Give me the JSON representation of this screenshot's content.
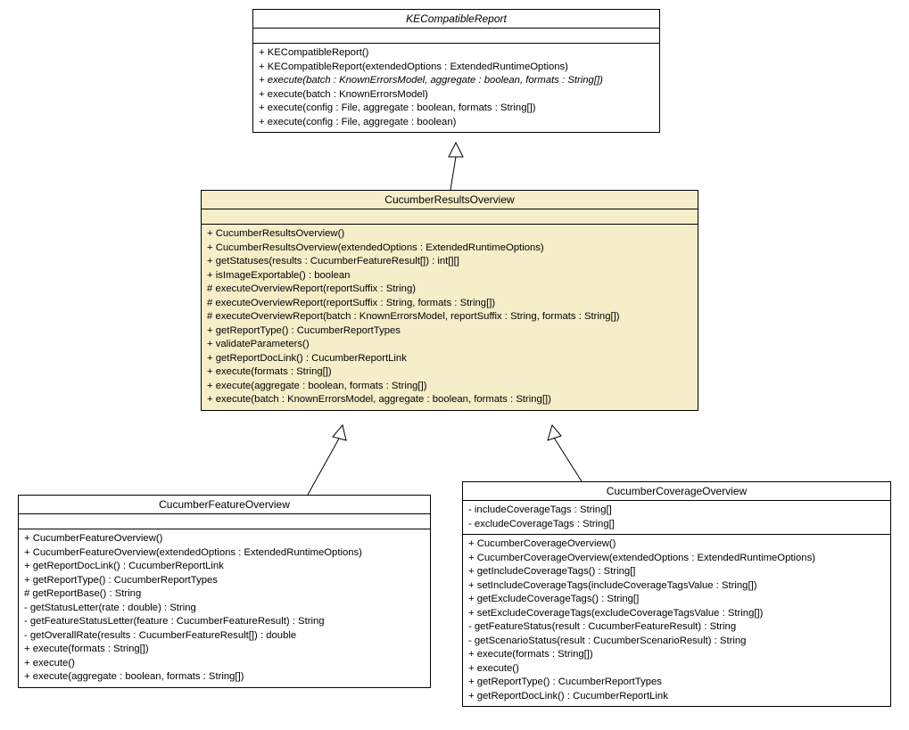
{
  "chart_data": {
    "type": "uml-class-diagram",
    "classes": [
      {
        "name": "KECompatibleReport",
        "abstract": true
      },
      {
        "name": "CucumberResultsOverview",
        "highlighted": true,
        "extends": "KECompatibleReport"
      },
      {
        "name": "CucumberFeatureOverview",
        "extends": "CucumberResultsOverview"
      },
      {
        "name": "CucumberCoverageOverview",
        "extends": "CucumberResultsOverview"
      }
    ],
    "relationships": [
      {
        "from": "CucumberResultsOverview",
        "to": "KECompatibleReport",
        "type": "generalization"
      },
      {
        "from": "CucumberFeatureOverview",
        "to": "CucumberResultsOverview",
        "type": "generalization"
      },
      {
        "from": "CucumberCoverageOverview",
        "to": "CucumberResultsOverview",
        "type": "generalization"
      }
    ]
  },
  "class1": {
    "title": "KECompatibleReport",
    "members": [
      {
        "sig": "+ KECompatibleReport()",
        "italic": false
      },
      {
        "sig": "+ KECompatibleReport(extendedOptions : ExtendedRuntimeOptions)",
        "italic": false
      },
      {
        "sig": "+ execute(batch : KnownErrorsModel, aggregate : boolean, formats : String[])",
        "italic": true
      },
      {
        "sig": "+ execute(batch : KnownErrorsModel)",
        "italic": false
      },
      {
        "sig": "+ execute(config : File, aggregate : boolean, formats : String[])",
        "italic": false
      },
      {
        "sig": "+ execute(config : File, aggregate : boolean)",
        "italic": false
      }
    ]
  },
  "class2": {
    "title": "CucumberResultsOverview",
    "members": [
      {
        "sig": "+ CucumberResultsOverview()",
        "italic": false
      },
      {
        "sig": "+ CucumberResultsOverview(extendedOptions : ExtendedRuntimeOptions)",
        "italic": false
      },
      {
        "sig": "+ getStatuses(results : CucumberFeatureResult[]) : int[][]",
        "italic": false
      },
      {
        "sig": "+ isImageExportable() : boolean",
        "italic": false
      },
      {
        "sig": "# executeOverviewReport(reportSuffix : String)",
        "italic": false
      },
      {
        "sig": "# executeOverviewReport(reportSuffix : String, formats : String[])",
        "italic": false
      },
      {
        "sig": "# executeOverviewReport(batch : KnownErrorsModel, reportSuffix : String, formats : String[])",
        "italic": false
      },
      {
        "sig": "+ getReportType() : CucumberReportTypes",
        "italic": false
      },
      {
        "sig": "+ validateParameters()",
        "italic": false
      },
      {
        "sig": "+ getReportDocLink() : CucumberReportLink",
        "italic": false
      },
      {
        "sig": "+ execute(formats : String[])",
        "italic": false
      },
      {
        "sig": "+ execute(aggregate : boolean, formats : String[])",
        "italic": false
      },
      {
        "sig": "+ execute(batch : KnownErrorsModel, aggregate : boolean, formats : String[])",
        "italic": false
      }
    ]
  },
  "class3": {
    "title": "CucumberFeatureOverview",
    "members": [
      {
        "sig": "+ CucumberFeatureOverview()",
        "italic": false
      },
      {
        "sig": "+ CucumberFeatureOverview(extendedOptions : ExtendedRuntimeOptions)",
        "italic": false
      },
      {
        "sig": "+ getReportDocLink() : CucumberReportLink",
        "italic": false
      },
      {
        "sig": "+ getReportType() : CucumberReportTypes",
        "italic": false
      },
      {
        "sig": "# getReportBase() : String",
        "italic": false
      },
      {
        "sig": "- getStatusLetter(rate : double) : String",
        "italic": false
      },
      {
        "sig": "- getFeatureStatusLetter(feature : CucumberFeatureResult) : String",
        "italic": false
      },
      {
        "sig": "- getOverallRate(results : CucumberFeatureResult[]) : double",
        "italic": false
      },
      {
        "sig": "+ execute(formats : String[])",
        "italic": false
      },
      {
        "sig": "+ execute()",
        "italic": false
      },
      {
        "sig": "+ execute(aggregate : boolean, formats : String[])",
        "italic": false
      }
    ]
  },
  "class4": {
    "title": "CucumberCoverageOverview",
    "attrs": [
      {
        "sig": "- includeCoverageTags : String[]"
      },
      {
        "sig": "- excludeCoverageTags : String[]"
      }
    ],
    "members": [
      {
        "sig": "+ CucumberCoverageOverview()",
        "italic": false
      },
      {
        "sig": "+ CucumberCoverageOverview(extendedOptions : ExtendedRuntimeOptions)",
        "italic": false
      },
      {
        "sig": "+ getIncludeCoverageTags() : String[]",
        "italic": false
      },
      {
        "sig": "+ setIncludeCoverageTags(includeCoverageTagsValue : String[])",
        "italic": false
      },
      {
        "sig": "+ getExcludeCoverageTags() : String[]",
        "italic": false
      },
      {
        "sig": "+ setExcludeCoverageTags(excludeCoverageTagsValue : String[])",
        "italic": false
      },
      {
        "sig": "- getFeatureStatus(result : CucumberFeatureResult) : String",
        "italic": false
      },
      {
        "sig": "- getScenarioStatus(result : CucumberScenarioResult) : String",
        "italic": false
      },
      {
        "sig": "+ execute(formats : String[])",
        "italic": false
      },
      {
        "sig": "+ execute()",
        "italic": false
      },
      {
        "sig": "+ getReportType() : CucumberReportTypes",
        "italic": false
      },
      {
        "sig": "+ getReportDocLink() : CucumberReportLink",
        "italic": false
      }
    ]
  }
}
